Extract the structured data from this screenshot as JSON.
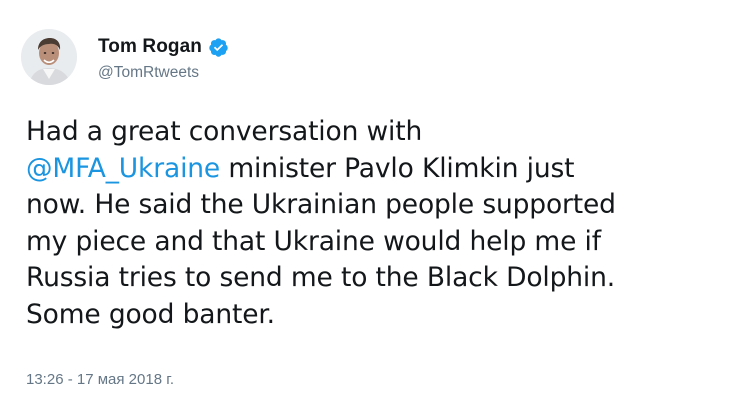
{
  "author": {
    "display_name": "Tom Rogan",
    "handle": "@TomRtweets",
    "verified": true,
    "avatar_icon": "profile-photo"
  },
  "tweet": {
    "segments": [
      {
        "text": "Had a great conversation with\n",
        "type": "text"
      },
      {
        "text": "@MFA_Ukraine",
        "type": "mention"
      },
      {
        "text": " minister Pavlo Klimkin just\nnow. He said the Ukrainian people supported\nmy piece and that Ukraine would help me if\nRussia tries to send me to the Black Dolphin.\nSome good banter.",
        "type": "text"
      }
    ],
    "timestamp": "13:26 - 17 мая 2018 г."
  },
  "colors": {
    "link": "#1b95e0",
    "verified_badge": "#1da1f2",
    "secondary_text": "#657786",
    "primary_text": "#14171a"
  }
}
